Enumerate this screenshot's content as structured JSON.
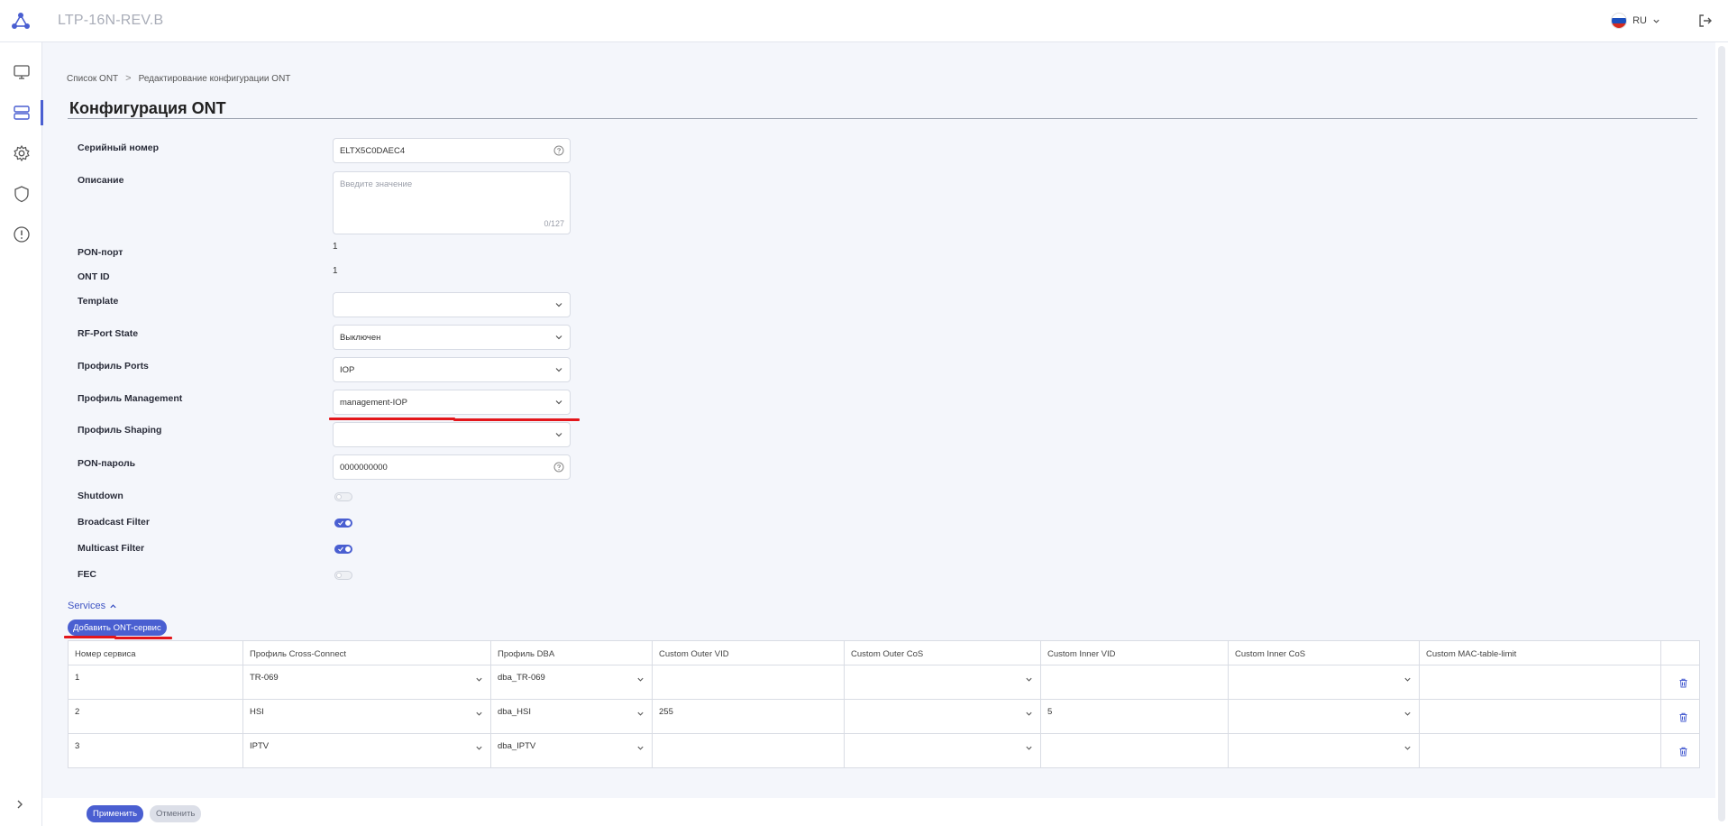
{
  "header": {
    "app_title": "LTP-16N-REV.B",
    "language": "RU",
    "flag_colors": [
      "#ffffff",
      "#1c4fbd",
      "#d52b1e"
    ]
  },
  "sidebar": {
    "items": [
      {
        "icon": "monitor-icon"
      },
      {
        "icon": "server-icon",
        "active": true
      },
      {
        "icon": "gear-icon"
      },
      {
        "icon": "shield-icon"
      },
      {
        "icon": "alert-circle-icon"
      }
    ],
    "expand_icon": "chevron-right-icon"
  },
  "breadcrumb": {
    "items": [
      "Список ONT",
      "Редактирование конфигурации ONT"
    ],
    "separator": ">"
  },
  "page": {
    "title": "Конфигурация ONT"
  },
  "form": {
    "serial": {
      "label": "Серийный номер",
      "value": "ELTX5C0DAEC4"
    },
    "description": {
      "label": "Описание",
      "placeholder": "Введите значение",
      "counter": "0/127"
    },
    "pon_port": {
      "label": "PON-порт",
      "value": "1"
    },
    "ont_id": {
      "label": "ONT ID",
      "value": "1"
    },
    "template": {
      "label": "Template",
      "value": ""
    },
    "rf_port_state": {
      "label": "RF-Port State",
      "value": "Выключен"
    },
    "profile_ports": {
      "label": "Профиль Ports",
      "value": "IOP"
    },
    "profile_management": {
      "label": "Профиль Management",
      "value": "management-IOP"
    },
    "profile_shaping": {
      "label": "Профиль Shaping",
      "value": ""
    },
    "pon_password": {
      "label": "PON-пароль",
      "value": "0000000000"
    },
    "shutdown": {
      "label": "Shutdown",
      "on": false
    },
    "broadcast_filter": {
      "label": "Broadcast Filter",
      "on": true
    },
    "multicast_filter": {
      "label": "Multicast Filter",
      "on": true
    },
    "fec": {
      "label": "FEC",
      "on": false
    }
  },
  "services": {
    "title": "Services",
    "add_button": "Добавить ONT-сервис",
    "columns": [
      "Номер сервиса",
      "Профиль Cross-Connect",
      "Профиль DBA",
      "Custom Outer VID",
      "Custom Outer CoS",
      "Custom Inner VID",
      "Custom Inner CoS",
      "Custom MAC-table-limit"
    ],
    "rows": [
      {
        "num": "1",
        "cross_connect": "TR-069",
        "dba": "dba_TR-069",
        "outer_vid": "",
        "outer_cos": "",
        "inner_vid": "",
        "inner_cos": "",
        "mac_limit": ""
      },
      {
        "num": "2",
        "cross_connect": "HSI",
        "dba": "dba_HSI",
        "outer_vid": "255",
        "outer_cos": "",
        "inner_vid": "5",
        "inner_cos": "",
        "mac_limit": ""
      },
      {
        "num": "3",
        "cross_connect": "IPTV",
        "dba": "dba_IPTV",
        "outer_vid": "",
        "outer_cos": "",
        "inner_vid": "",
        "inner_cos": "",
        "mac_limit": ""
      }
    ]
  },
  "footer": {
    "apply": "Применить",
    "cancel": "Отменить"
  },
  "colors": {
    "accent": "#4a5fd1",
    "annotation_red": "#e3161b"
  }
}
